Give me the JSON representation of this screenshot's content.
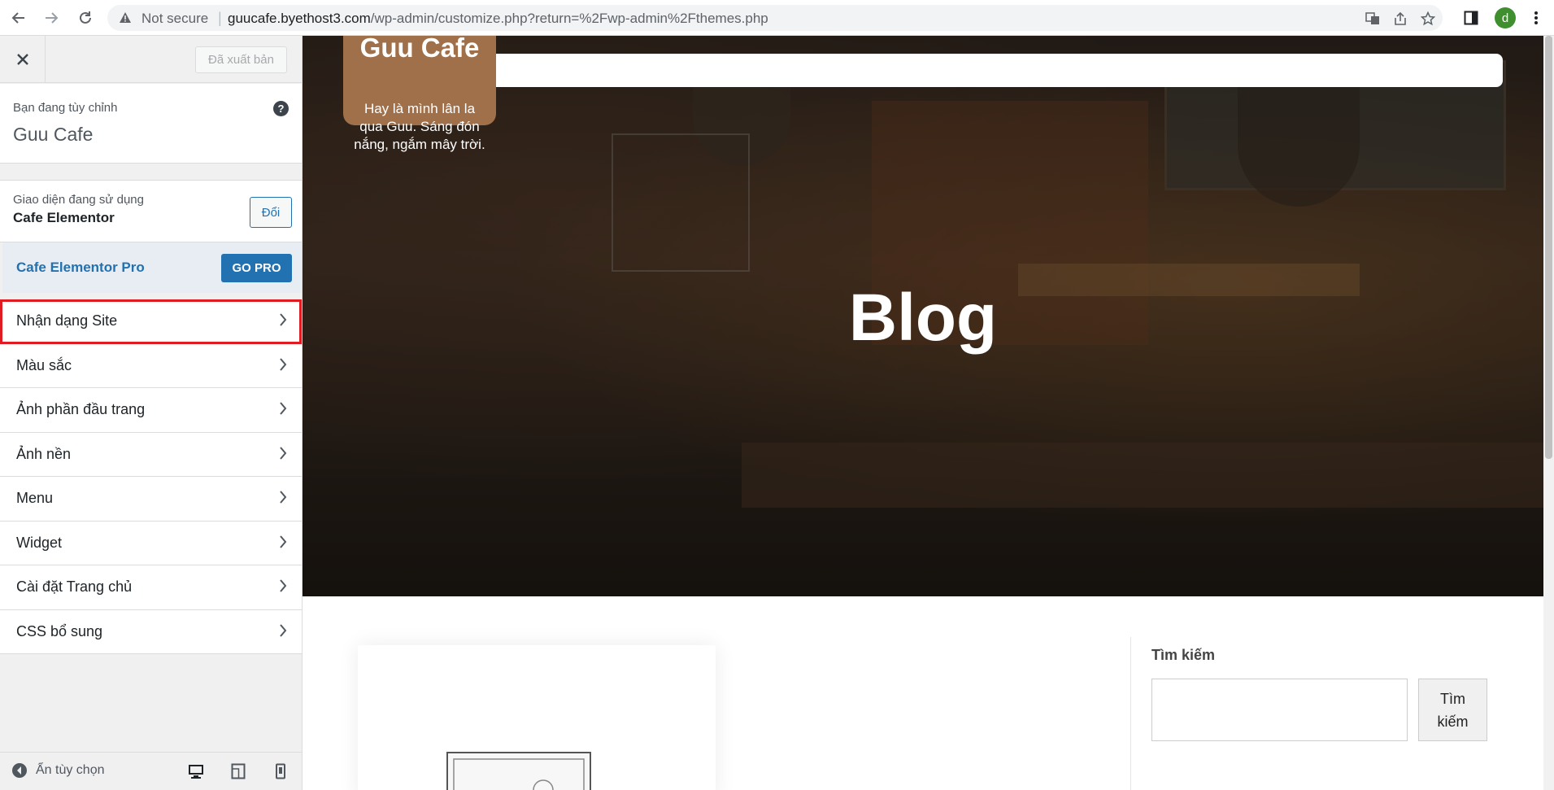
{
  "browser": {
    "security_label": "Not secure",
    "url_host": "guucafe.byethost3.com",
    "url_path": "/wp-admin/customize.php?return=%2Fwp-admin%2Fthemes.php",
    "profile_initial": "d"
  },
  "customizer": {
    "publish_label": "Đã xuất bản",
    "customizing_label": "Bạn đang tùy chỉnh",
    "site_name": "Guu Cafe",
    "theme_label": "Giao diện đang sử dụng",
    "theme_name": "Cafe Elementor",
    "change_label": "Đổi",
    "pro_label": "Cafe Elementor Pro",
    "go_pro_label": "GO PRO",
    "menu": [
      {
        "label": "Nhận dạng Site"
      },
      {
        "label": "Màu sắc"
      },
      {
        "label": "Ảnh phần đầu trang"
      },
      {
        "label": "Ảnh nền"
      },
      {
        "label": "Menu"
      },
      {
        "label": "Widget"
      },
      {
        "label": "Cài đặt Trang chủ"
      },
      {
        "label": "CSS bổ sung"
      }
    ],
    "hide_controls_label": "Ẩn tùy chọn"
  },
  "preview": {
    "logo_title": "Guu Cafe",
    "tagline": "Hay là mình lân la qua Guu. Sáng đón nắng, ngắm mây trời.",
    "hero_title": "Blog",
    "search_heading": "Tìm kiếm",
    "search_button": "Tìm kiếm"
  },
  "colors": {
    "accent": "#2271b1",
    "highlight": "#e11b22",
    "logo_bg": "#a0704a"
  }
}
